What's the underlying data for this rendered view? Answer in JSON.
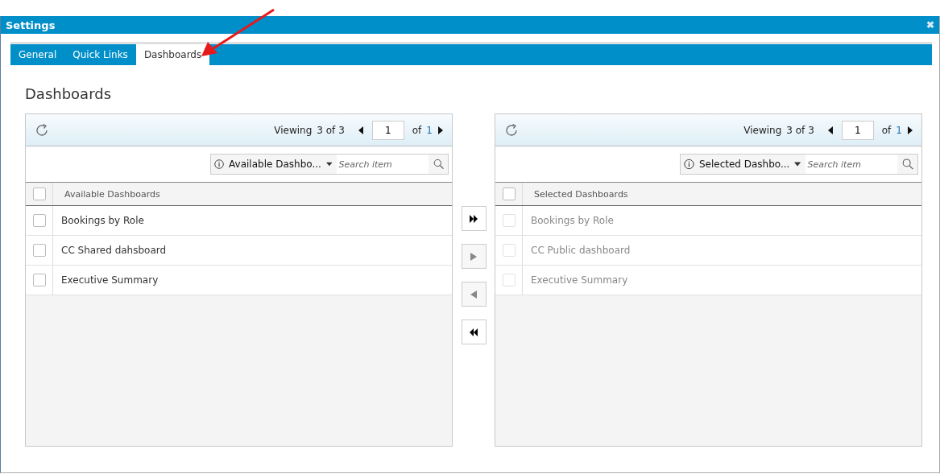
{
  "window": {
    "title": "Settings",
    "close": "✖"
  },
  "tabs": [
    {
      "label": "General",
      "selected": false
    },
    {
      "label": "Quick Links",
      "selected": false
    },
    {
      "label": "Dashboards",
      "selected": true
    }
  ],
  "heading": "Dashboards",
  "lists": [
    {
      "viewing": "Viewing",
      "count": "3 of 3",
      "page": "1",
      "of": "of",
      "pages": "1",
      "filter": "Available Dashbo...",
      "placeholder": "Search item",
      "column": "Available Dashboards",
      "select_all_checked": false,
      "rows": [
        {
          "label": "Bookings by Role",
          "disabled": false
        },
        {
          "label": "CC Shared dahsboard",
          "disabled": false
        },
        {
          "label": "Executive Summary",
          "disabled": false
        }
      ]
    },
    {
      "viewing": "Viewing",
      "count": "3 of 3",
      "page": "1",
      "of": "of",
      "pages": "1",
      "filter": "Selected Dashbo...",
      "placeholder": "Search item",
      "column": "Selected Dashboards",
      "select_all_checked": false,
      "rows": [
        {
          "label": "Bookings by Role",
          "disabled": true
        },
        {
          "label": "CC Public dashboard",
          "disabled": true
        },
        {
          "label": "Executive Summary",
          "disabled": true
        }
      ]
    }
  ],
  "transfer_buttons": [
    {
      "kind": "all_right",
      "disabled": false
    },
    {
      "kind": "right",
      "disabled": true
    },
    {
      "kind": "left",
      "disabled": true
    },
    {
      "kind": "all_left",
      "disabled": false
    }
  ]
}
